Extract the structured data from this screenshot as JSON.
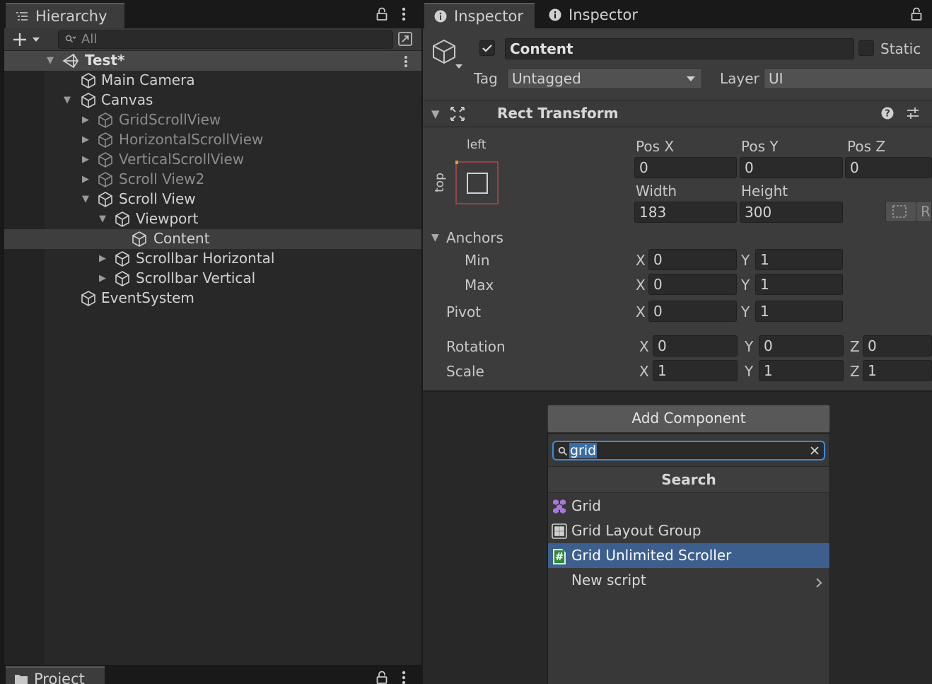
{
  "hierarchy": {
    "tab_label": "Hierarchy",
    "search_placeholder": "All",
    "scene": "Test*",
    "items": [
      {
        "label": "Main Camera"
      },
      {
        "label": "Canvas"
      },
      {
        "label": "GridScrollView"
      },
      {
        "label": "HorizontalScrollView"
      },
      {
        "label": "VerticalScrollView"
      },
      {
        "label": "Scroll View2"
      },
      {
        "label": "Scroll View"
      },
      {
        "label": "Viewport"
      },
      {
        "label": "Content"
      },
      {
        "label": "Scrollbar Horizontal"
      },
      {
        "label": "Scrollbar Vertical"
      },
      {
        "label": "EventSystem"
      }
    ]
  },
  "project": {
    "tab_label": "Project"
  },
  "inspector": {
    "tab1_label": "Inspector",
    "tab2_label": "Inspector",
    "object_name": "Content",
    "static_label": "Static",
    "tag_label": "Tag",
    "tag_value": "Untagged",
    "layer_label": "Layer",
    "layer_value": "UI",
    "rect_transform": {
      "title": "Rect Transform",
      "anchor_preset_h": "left",
      "anchor_preset_v": "top",
      "pos_x_label": "Pos X",
      "pos_x": "0",
      "pos_y_label": "Pos Y",
      "pos_y": "0",
      "pos_z_label": "Pos Z",
      "pos_z": "0",
      "width_label": "Width",
      "width": "183",
      "height_label": "Height",
      "height": "300",
      "anchors_label": "Anchors",
      "min_label": "Min",
      "min_x": "0",
      "min_y": "1",
      "max_label": "Max",
      "max_x": "0",
      "max_y": "1",
      "pivot_label": "Pivot",
      "pivot_x": "0",
      "pivot_y": "1",
      "rotation_label": "Rotation",
      "rot_x": "0",
      "rot_y": "0",
      "rot_z": "0",
      "scale_label": "Scale",
      "scale_x": "1",
      "scale_y": "1",
      "scale_z": "1",
      "x": "X",
      "y": "Y",
      "z": "Z",
      "r_button": "R"
    }
  },
  "add_component": {
    "button_label": "Add Component",
    "search_value": "grid",
    "section_title": "Search",
    "items": [
      {
        "label": "Grid",
        "icon": "grid-icon"
      },
      {
        "label": "Grid Layout Group",
        "icon": "grid-layout-icon"
      },
      {
        "label": "Grid Unlimited Scroller",
        "icon": "script-icon"
      },
      {
        "label": "New script",
        "icon": "chevron-right-icon"
      }
    ]
  },
  "colors": {
    "panel_bg": "#282828",
    "header_bg": "#3c3c3c",
    "selection": "#3d5f8e",
    "focus_outline": "#3d8cd8"
  }
}
